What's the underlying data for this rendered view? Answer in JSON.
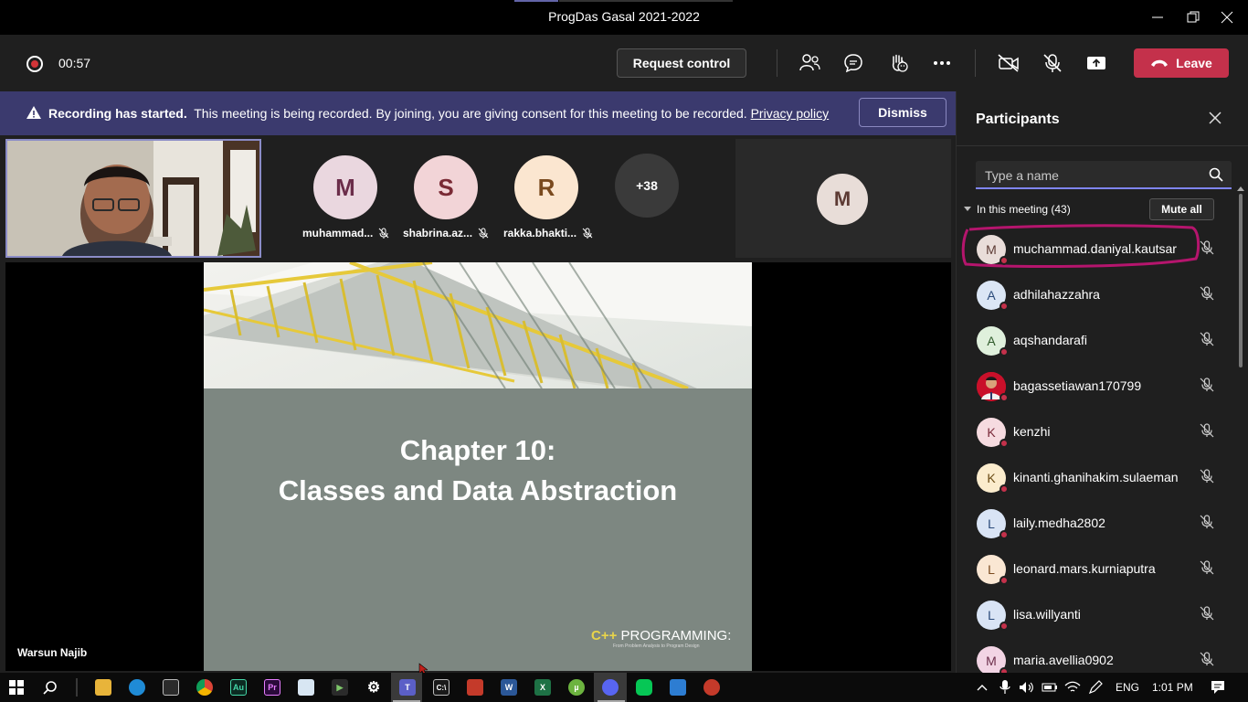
{
  "window": {
    "title": "ProgDas Gasal 2021-2022"
  },
  "toolbar": {
    "timer": "00:57",
    "request_control": "Request control",
    "leave": "Leave"
  },
  "banner": {
    "heading": "Recording has started.",
    "message": "This meeting is being recorded. By joining, you are giving consent for this meeting to be recorded.",
    "link": "Privacy policy",
    "dismiss": "Dismiss"
  },
  "stage": {
    "tiles": [
      {
        "initial": "M",
        "name": "muhammad...",
        "bg": "#ead7df",
        "fg": "#6b2d4a"
      },
      {
        "initial": "S",
        "name": "shabrina.az...",
        "bg": "#f2d4d7",
        "fg": "#7a2a35"
      },
      {
        "initial": "R",
        "name": "rakka.bhakti...",
        "bg": "#fbe6d0",
        "fg": "#7a4a1e"
      }
    ],
    "more_count": "+38",
    "side_initial": "M",
    "presenter": "Warsun Najib",
    "slide": {
      "line1": "Chapter 10:",
      "line2": "Classes and Data Abstraction",
      "logo_prefix": "C++",
      "logo_text": "PROGRAMMING:",
      "logo_sub": "From Problem Analysis to Program Design"
    }
  },
  "panel": {
    "title": "Participants",
    "search_placeholder": "Type a name",
    "section": "In this meeting (43)",
    "mute_all": "Mute all",
    "participants": [
      {
        "initial": "M",
        "name": "muchammad.daniyal.kautsar",
        "bg": "#e9ddd9",
        "fg": "#5c3a33"
      },
      {
        "initial": "A",
        "name": "adhilahazzahra",
        "bg": "#dbe6f5",
        "fg": "#2a4a7a"
      },
      {
        "initial": "A",
        "name": "aqshandarafi",
        "bg": "#dff0dc",
        "fg": "#2e5a2a"
      },
      {
        "initial": "",
        "name": "bagassetiawan170799",
        "bg": "#c9102a",
        "fg": "#ffffff"
      },
      {
        "initial": "K",
        "name": "kenzhi",
        "bg": "#f6dbe0",
        "fg": "#7a2a3a"
      },
      {
        "initial": "K",
        "name": "kinanti.ghanihakim.sulaeman",
        "bg": "#fbeccd",
        "fg": "#6a4a12"
      },
      {
        "initial": "L",
        "name": "laily.medha2802",
        "bg": "#d9e4f5",
        "fg": "#2a4a7a"
      },
      {
        "initial": "L",
        "name": "leonard.mars.kurniaputra",
        "bg": "#fae7d3",
        "fg": "#7a4a1e"
      },
      {
        "initial": "L",
        "name": "lisa.willyanti",
        "bg": "#d9e4f5",
        "fg": "#2a4a7a"
      },
      {
        "initial": "M",
        "name": "maria.avellia0902",
        "bg": "#f2d4e4",
        "fg": "#6b2d4a"
      }
    ]
  },
  "taskbar": {
    "language": "ENG",
    "time": "1:01 PM"
  }
}
